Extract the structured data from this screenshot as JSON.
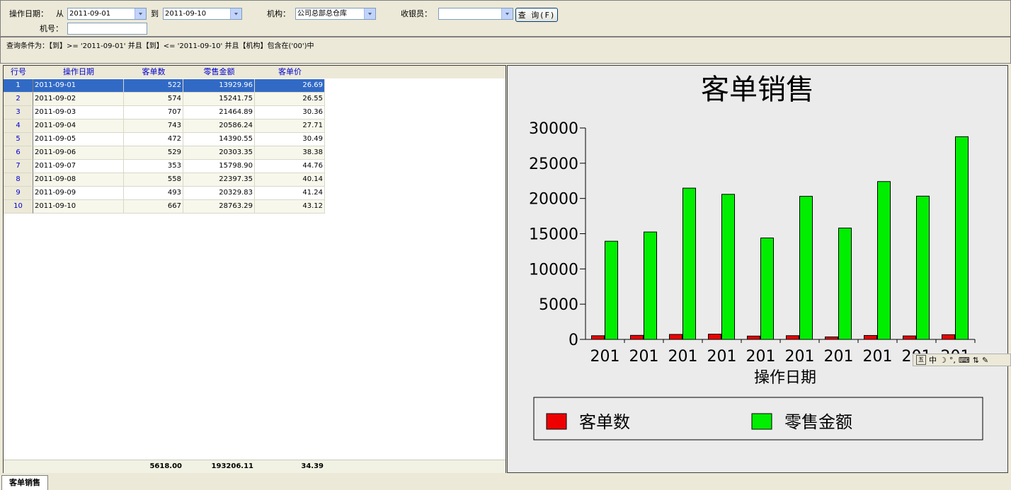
{
  "filter": {
    "date_label": "操作日期：",
    "from_label": "从",
    "from_value": "2011-09-01",
    "to_label": "到",
    "to_value": "2011-09-10",
    "org_label": "机构：",
    "org_value": "公司总部总仓库",
    "cashier_label": "收银员：",
    "cashier_value": "",
    "machine_label": "机号：",
    "machine_value": "",
    "query_button": "查 询(F)"
  },
  "condition_text": "查询条件为：【到】>= '2011-09-01' 并且【到】<= '2011-09-10' 并且【机构】包含在('00')中",
  "grid": {
    "columns": [
      "行号",
      "操作日期",
      "客单数",
      "零售金额",
      "客单价"
    ],
    "rows": [
      {
        "no": "1",
        "date": "2011-09-01",
        "orders": "522",
        "amount": "13929.96",
        "price": "26.69"
      },
      {
        "no": "2",
        "date": "2011-09-02",
        "orders": "574",
        "amount": "15241.75",
        "price": "26.55"
      },
      {
        "no": "3",
        "date": "2011-09-03",
        "orders": "707",
        "amount": "21464.89",
        "price": "30.36"
      },
      {
        "no": "4",
        "date": "2011-09-04",
        "orders": "743",
        "amount": "20586.24",
        "price": "27.71"
      },
      {
        "no": "5",
        "date": "2011-09-05",
        "orders": "472",
        "amount": "14390.55",
        "price": "30.49"
      },
      {
        "no": "6",
        "date": "2011-09-06",
        "orders": "529",
        "amount": "20303.35",
        "price": "38.38"
      },
      {
        "no": "7",
        "date": "2011-09-07",
        "orders": "353",
        "amount": "15798.90",
        "price": "44.76"
      },
      {
        "no": "8",
        "date": "2011-09-08",
        "orders": "558",
        "amount": "22397.35",
        "price": "40.14"
      },
      {
        "no": "9",
        "date": "2011-09-09",
        "orders": "493",
        "amount": "20329.83",
        "price": "41.24"
      },
      {
        "no": "10",
        "date": "2011-09-10",
        "orders": "667",
        "amount": "28763.29",
        "price": "43.12"
      }
    ],
    "selected_row": 0,
    "footer": {
      "orders": "5618.00",
      "amount": "193206.11",
      "price": "34.39"
    }
  },
  "chart_data": {
    "type": "bar",
    "title": "客单销售",
    "xlabel": "操作日期",
    "ylabel": "",
    "categories": [
      "201",
      "201",
      "201",
      "201",
      "201",
      "201",
      "201",
      "201",
      "201",
      "201"
    ],
    "series": [
      {
        "name": "客单数",
        "color": "#ee0000",
        "values": [
          522,
          574,
          707,
          743,
          472,
          529,
          353,
          558,
          493,
          667
        ]
      },
      {
        "name": "零售金额",
        "color": "#00ee00",
        "values": [
          13929.96,
          15241.75,
          21464.89,
          20586.24,
          14390.55,
          20303.35,
          15798.9,
          22397.35,
          20329.83,
          28763.29
        ]
      }
    ],
    "ylim": [
      0,
      30000
    ],
    "yticks": [
      "0",
      "5000",
      "10000",
      "15000",
      "20000",
      "25000",
      "30000"
    ],
    "legend_position": "bottom",
    "grid": false
  },
  "ime": {
    "label": "中"
  },
  "tab": {
    "label": "客单销售"
  }
}
